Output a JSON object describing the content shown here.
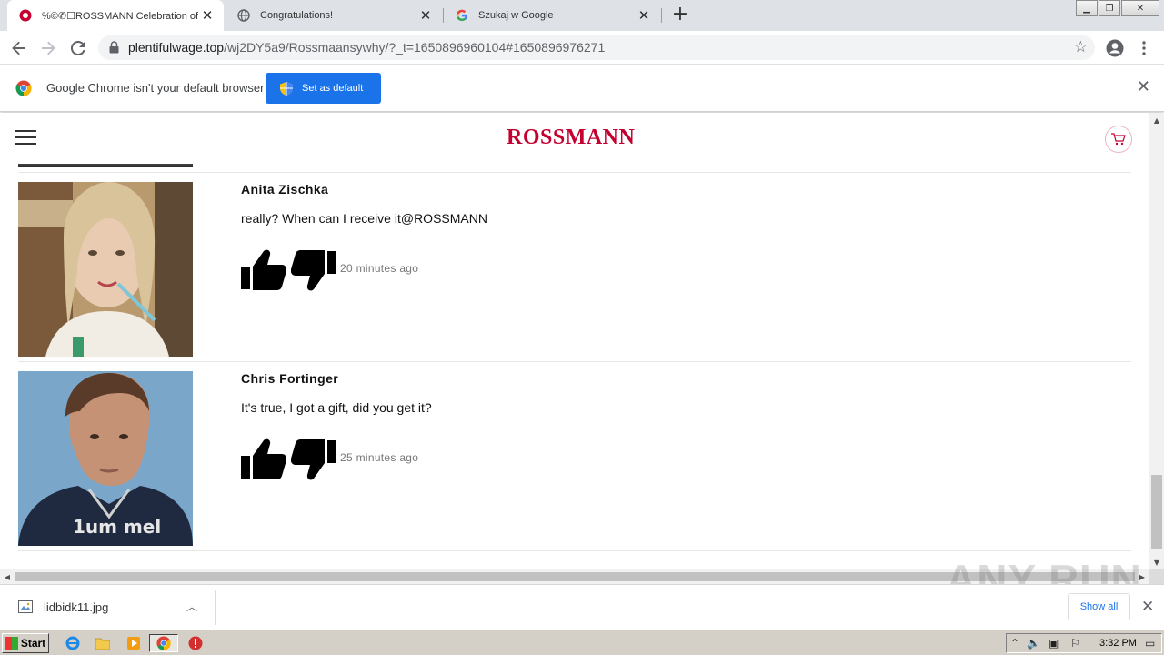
{
  "browser": {
    "tabs": [
      {
        "title": "ROSSMANN Celebration of the",
        "prefix_glyphs": "%©✆☐",
        "active": true
      },
      {
        "title": "Congratulations!",
        "active": false
      },
      {
        "title": "Szukaj w Google",
        "active": false
      }
    ],
    "url_host": "plentifulwage.top",
    "url_path": "/wj2DY5a9/Rossmaansywhy/?_t=1650896960104#1650896976271"
  },
  "infobar": {
    "message": "Google Chrome isn't your default browser",
    "button_label": "Set as default"
  },
  "site": {
    "logo_text": "ROSSMANN",
    "brand_color": "#c3002f"
  },
  "comments": [
    {
      "name": "Anita Zischka",
      "text": "really? When can I receive it@ROSSMANN",
      "time": "20 minutes ago"
    },
    {
      "name": "Chris Fortinger",
      "text": "It's true, I got a gift, did you get it?",
      "time": "25 minutes ago"
    }
  ],
  "avatar_text": "1um mel",
  "download": {
    "filename": "lidbidk11.jpg",
    "show_all_label": "Show all"
  },
  "watermark": "ANY RUN",
  "taskbar": {
    "start_label": "Start",
    "clock": "3:32 PM"
  }
}
